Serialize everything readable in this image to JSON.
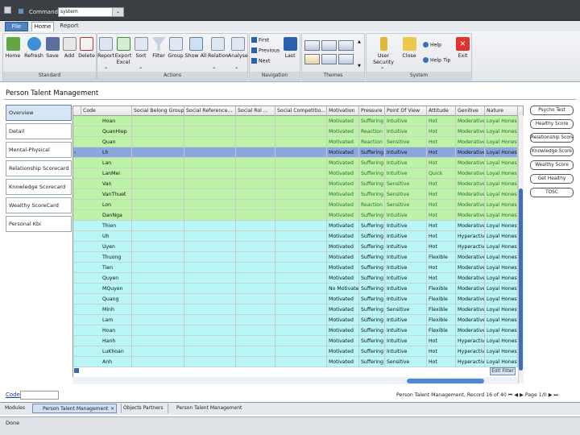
{
  "titlebar": {
    "command_label": "Command",
    "command_value": "system"
  },
  "tabs": {
    "app_button": "File",
    "home": "Home",
    "report": "Report"
  },
  "ribbon": {
    "groups": {
      "standard": "Standard",
      "actions": "Actions",
      "navigation": "Navigation",
      "themes": "Themes",
      "system": "System"
    },
    "standard": [
      {
        "label": "Home",
        "icon": "home-icon"
      },
      {
        "label": "Refresh",
        "icon": "refresh-icon"
      },
      {
        "label": "Save",
        "icon": "save-icon"
      },
      {
        "label": "Add",
        "icon": "add-icon"
      },
      {
        "label": "Delete",
        "icon": "delete-icon"
      }
    ],
    "actions": [
      {
        "label": "Report",
        "icon": "report-icon"
      },
      {
        "label": "Export Excel",
        "icon": "excel-icon"
      },
      {
        "label": "Sort",
        "icon": "sort-icon"
      },
      {
        "label": "Filter",
        "icon": "filter-icon"
      },
      {
        "label": "Group",
        "icon": "group-icon"
      },
      {
        "label": "Show All",
        "icon": "show-all-icon"
      },
      {
        "label": "Relation",
        "icon": "relation-icon"
      },
      {
        "label": "Analyse",
        "icon": "analyse-icon"
      }
    ],
    "navigation": {
      "first": "First",
      "previous": "Previous",
      "next": "Next",
      "last": "Last"
    },
    "system": {
      "user_security": "User Security",
      "close": "Close",
      "help": "Help",
      "help_tip": "Help Tip",
      "exit": "Exit"
    }
  },
  "page_title": "Person Talent Management",
  "left_nav": [
    "Overview",
    "Detail",
    "Mental-Physical Scorecard",
    "Relationship Scorecard",
    "Knowledge Scorecard",
    "Wealthy ScoreCard",
    "Personal Kbi"
  ],
  "grid": {
    "columns": [
      "Code",
      "Social Belong Group",
      "Social Reference...",
      "Social Rol ...",
      "Social Competitio...",
      "Motivation",
      "Pressure",
      "Point Of View",
      "Attitude",
      "Genitive",
      "Nature"
    ],
    "rows": [
      {
        "code": "Hoan",
        "motivation": "Motivated",
        "pressure": "Suffering",
        "pov": "Intuitive",
        "attitude": "Hot",
        "genitive": "Moderative",
        "nature": "Loyal Honesty",
        "tone": "green"
      },
      {
        "code": "QuanHiep",
        "motivation": "Motivated",
        "pressure": "Reaction",
        "pov": "Intuitive",
        "attitude": "Hot",
        "genitive": "Moderative",
        "nature": "Loyal Honesty",
        "tone": "green"
      },
      {
        "code": "Quan",
        "motivation": "Motivated",
        "pressure": "Reaction",
        "pov": "Sensitive",
        "attitude": "Hot",
        "genitive": "Moderative",
        "nature": "Loyal Honesty",
        "tone": "green"
      },
      {
        "code": "Lh",
        "motivation": "Motivated",
        "pressure": "Suffering",
        "pov": "Intuitive",
        "attitude": "Hot",
        "genitive": "Moderative",
        "nature": "Loyal Honesty",
        "tone": "selected"
      },
      {
        "code": "Lan",
        "motivation": "Motivated",
        "pressure": "Suffering",
        "pov": "Intuitive",
        "attitude": "Hot",
        "genitive": "Moderative",
        "nature": "Loyal Honesty",
        "tone": "green"
      },
      {
        "code": "LanMei",
        "motivation": "Motivated",
        "pressure": "Suffering",
        "pov": "Intuitive",
        "attitude": "Quick",
        "genitive": "Moderative",
        "nature": "Loyal Honesty",
        "tone": "green"
      },
      {
        "code": "Van",
        "motivation": "Motivated",
        "pressure": "Suffering",
        "pov": "Sensitive",
        "attitude": "Hot",
        "genitive": "Moderative",
        "nature": "Loyal Honesty",
        "tone": "green"
      },
      {
        "code": "VanThuet",
        "motivation": "Motivated",
        "pressure": "Suffering",
        "pov": "Sensitive",
        "attitude": "Hot",
        "genitive": "Moderative",
        "nature": "Loyal Honesty",
        "tone": "green"
      },
      {
        "code": "Lon",
        "motivation": "Motivated",
        "pressure": "Reaction",
        "pov": "Sensitive",
        "attitude": "Hot",
        "genitive": "Moderative",
        "nature": "Loyal Honesty",
        "tone": "green"
      },
      {
        "code": "DanNga",
        "motivation": "Motivated",
        "pressure": "Suffering",
        "pov": "Intuitive",
        "attitude": "Hot",
        "genitive": "Moderative",
        "nature": "Loyal Honesty",
        "tone": "green"
      },
      {
        "code": "Thien",
        "motivation": "Motivated",
        "pressure": "Suffering",
        "pov": "Intuitive",
        "attitude": "Hot",
        "genitive": "Moderative",
        "nature": "Loyal Honesty",
        "tone": "cyan"
      },
      {
        "code": "Uh",
        "motivation": "Motivated",
        "pressure": "Suffering",
        "pov": "Intuitive",
        "attitude": "Hot",
        "genitive": "Hyperactive",
        "nature": "Loyal Honesty",
        "tone": "cyan"
      },
      {
        "code": "Uyen",
        "motivation": "Motivated",
        "pressure": "Suffering",
        "pov": "Intuitive",
        "attitude": "Hot",
        "genitive": "Hyperactive",
        "nature": "Loyal Honesty",
        "tone": "cyan"
      },
      {
        "code": "Thuong",
        "motivation": "Motivated",
        "pressure": "Suffering",
        "pov": "Intuitive",
        "attitude": "Flexible",
        "genitive": "Moderative",
        "nature": "Loyal Honesty",
        "tone": "cyan"
      },
      {
        "code": "Tien",
        "motivation": "Motivated",
        "pressure": "Suffering",
        "pov": "Intuitive",
        "attitude": "Hot",
        "genitive": "Moderative",
        "nature": "Loyal Honesty",
        "tone": "cyan"
      },
      {
        "code": "Quyen",
        "motivation": "Motivated",
        "pressure": "Suffering",
        "pov": "Intuitive",
        "attitude": "Hot",
        "genitive": "Moderative",
        "nature": "Loyal Honesty",
        "tone": "cyan"
      },
      {
        "code": "MQuyen",
        "motivation": "No Motivated",
        "pressure": "Suffering",
        "pov": "Intuitive",
        "attitude": "Flexible",
        "genitive": "Moderative",
        "nature": "Loyal Honesty",
        "tone": "cyan"
      },
      {
        "code": "Quang",
        "motivation": "Motivated",
        "pressure": "Suffering",
        "pov": "Intuitive",
        "attitude": "Flexible",
        "genitive": "Moderative",
        "nature": "Loyal Honesty",
        "tone": "cyan"
      },
      {
        "code": "Minh",
        "motivation": "Motivated",
        "pressure": "Suffering",
        "pov": "Sensitive",
        "attitude": "Flexible",
        "genitive": "Moderative",
        "nature": "Loyal Honesty",
        "tone": "cyan"
      },
      {
        "code": "Lam",
        "motivation": "Motivated",
        "pressure": "Suffering",
        "pov": "Intuitive",
        "attitude": "Flexible",
        "genitive": "Moderative",
        "nature": "Loyal Honesty",
        "tone": "cyan"
      },
      {
        "code": "Hoan",
        "motivation": "Motivated",
        "pressure": "Suffering",
        "pov": "Intuitive",
        "attitude": "Flexible",
        "genitive": "Moderative",
        "nature": "Loyal Honesty",
        "tone": "cyan"
      },
      {
        "code": "Hanh",
        "motivation": "Motivated",
        "pressure": "Suffering",
        "pov": "Intuitive",
        "attitude": "Hot",
        "genitive": "Hyperactive",
        "nature": "Loyal Honesty",
        "tone": "cyan"
      },
      {
        "code": "LuKhoan",
        "motivation": "Motivated",
        "pressure": "Suffering",
        "pov": "Intuitive",
        "attitude": "Hot",
        "genitive": "Hyperactive",
        "nature": "Loyal Honesty",
        "tone": "cyan"
      },
      {
        "code": "Anh",
        "motivation": "Motivated",
        "pressure": "Suffering",
        "pov": "Sensitive",
        "attitude": "Hot",
        "genitive": "Hyperactive",
        "nature": "Loyal Honesty",
        "tone": "cyan"
      }
    ],
    "edit_filter": "Edit Filter"
  },
  "right_buttons": [
    "Psycho Test",
    "Healthy Score",
    "Relationship Score",
    "Knowledge Score",
    "Wealthy Score",
    "Get Healthy",
    "TOSC"
  ],
  "footer": {
    "code_label": "Code",
    "record_status": "Person Talent Management, Record 16 of 40",
    "page": "Page 1/0"
  },
  "bottom_tabs": [
    "Modules",
    "Person Talent Management",
    "Objects Partners",
    "Person Talent Management"
  ],
  "status": "Done",
  "colors": {
    "green": "#bdf3a6",
    "cyan": "#b8f6f8",
    "selected": "#8aa7de",
    "hot_text": "#2a6d2a"
  }
}
